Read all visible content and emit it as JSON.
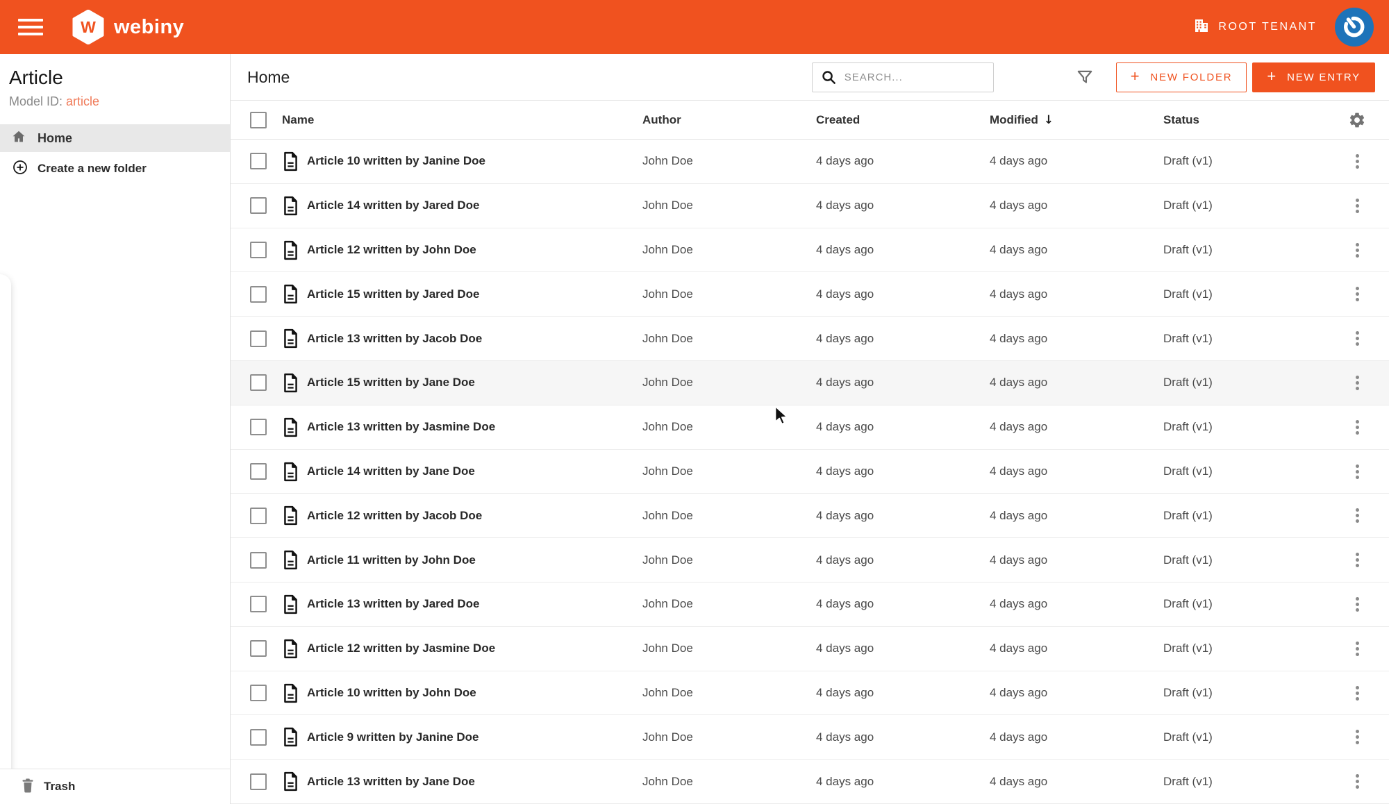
{
  "colors": {
    "accent": "#F0521F",
    "accent_light": "#F07A58",
    "avatar_blue": "#1E73B9"
  },
  "header": {
    "brand": "webiny",
    "brand_letter": "W",
    "tenant_label": "ROOT TENANT"
  },
  "sidebar": {
    "title": "Article",
    "model_id_label": "Model ID:",
    "model_id_value": "article",
    "home_label": "Home",
    "create_folder_label": "Create a new folder",
    "trash_label": "Trash"
  },
  "toolbar": {
    "title": "Home",
    "search_placeholder": "SEARCH...",
    "plus_glyph": "+",
    "new_folder_label": "NEW FOLDER",
    "new_entry_label": "NEW ENTRY"
  },
  "table": {
    "columns": {
      "name": "Name",
      "author": "Author",
      "created": "Created",
      "modified": "Modified",
      "status": "Status"
    },
    "sort_column": "Modified",
    "sort_icon": "↓",
    "rows": [
      {
        "name": "Article 10 written by Janine Doe",
        "author": "John Doe",
        "created": "4 days ago",
        "modified": "4 days ago",
        "status": "Draft (v1)",
        "hovered": false
      },
      {
        "name": "Article 14 written by Jared Doe",
        "author": "John Doe",
        "created": "4 days ago",
        "modified": "4 days ago",
        "status": "Draft (v1)",
        "hovered": false
      },
      {
        "name": "Article 12 written by John Doe",
        "author": "John Doe",
        "created": "4 days ago",
        "modified": "4 days ago",
        "status": "Draft (v1)",
        "hovered": false
      },
      {
        "name": "Article 15 written by Jared Doe",
        "author": "John Doe",
        "created": "4 days ago",
        "modified": "4 days ago",
        "status": "Draft (v1)",
        "hovered": false
      },
      {
        "name": "Article 13 written by Jacob Doe",
        "author": "John Doe",
        "created": "4 days ago",
        "modified": "4 days ago",
        "status": "Draft (v1)",
        "hovered": false
      },
      {
        "name": "Article 15 written by Jane Doe",
        "author": "John Doe",
        "created": "4 days ago",
        "modified": "4 days ago",
        "status": "Draft (v1)",
        "hovered": true
      },
      {
        "name": "Article 13 written by Jasmine Doe",
        "author": "John Doe",
        "created": "4 days ago",
        "modified": "4 days ago",
        "status": "Draft (v1)",
        "hovered": false
      },
      {
        "name": "Article 14 written by Jane Doe",
        "author": "John Doe",
        "created": "4 days ago",
        "modified": "4 days ago",
        "status": "Draft (v1)",
        "hovered": false
      },
      {
        "name": "Article 12 written by Jacob Doe",
        "author": "John Doe",
        "created": "4 days ago",
        "modified": "4 days ago",
        "status": "Draft (v1)",
        "hovered": false
      },
      {
        "name": "Article 11 written by John Doe",
        "author": "John Doe",
        "created": "4 days ago",
        "modified": "4 days ago",
        "status": "Draft (v1)",
        "hovered": false
      },
      {
        "name": "Article 13 written by Jared Doe",
        "author": "John Doe",
        "created": "4 days ago",
        "modified": "4 days ago",
        "status": "Draft (v1)",
        "hovered": false
      },
      {
        "name": "Article 12 written by Jasmine Doe",
        "author": "John Doe",
        "created": "4 days ago",
        "modified": "4 days ago",
        "status": "Draft (v1)",
        "hovered": false
      },
      {
        "name": "Article 10 written by John Doe",
        "author": "John Doe",
        "created": "4 days ago",
        "modified": "4 days ago",
        "status": "Draft (v1)",
        "hovered": false
      },
      {
        "name": "Article 9 written by Janine Doe",
        "author": "John Doe",
        "created": "4 days ago",
        "modified": "4 days ago",
        "status": "Draft (v1)",
        "hovered": false
      },
      {
        "name": "Article 13 written by Jane Doe",
        "author": "John Doe",
        "created": "4 days ago",
        "modified": "4 days ago",
        "status": "Draft (v1)",
        "hovered": false
      }
    ]
  }
}
